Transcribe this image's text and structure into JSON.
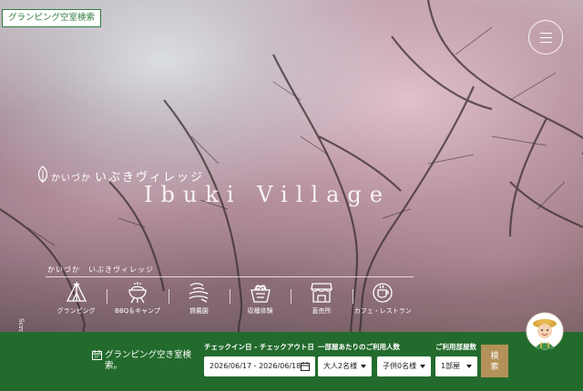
{
  "header": {
    "badge_label": "グランピング空室検索",
    "menu_icon": "hamburger-icon"
  },
  "hero": {
    "logo_small": "かいづか",
    "logo_big": "いぶきヴィレッジ",
    "logo_en": "Ibuki Village"
  },
  "categories": {
    "title": "かいづか　いぶきヴィレッジ",
    "items": [
      {
        "label": "グランピング",
        "icon": "tent-icon"
      },
      {
        "label": "BBQ＆キャンプ",
        "icon": "grill-icon"
      },
      {
        "label": "貸農園",
        "icon": "farm-icon"
      },
      {
        "label": "収穫体験",
        "icon": "harvest-basket-icon"
      },
      {
        "label": "直売所",
        "icon": "shop-icon"
      },
      {
        "label": "カフェ・レストラン",
        "icon": "cafe-icon"
      }
    ]
  },
  "scroll_label": "Scroll",
  "search": {
    "title": "グランピング空き室検索。",
    "date_label": "チェックイン日 - チェックアウト日",
    "date_value": "2026/06/17 - 2026/06/18",
    "guests_label": "一部屋あたりのご利用人数",
    "adults_value": "大人2名様",
    "children_value": "子供0名様",
    "rooms_label": "ご利用部屋数",
    "rooms_value": "1部屋",
    "button_line1": "検",
    "button_line2": "索"
  },
  "colors": {
    "brand_green": "#236b2d",
    "button_gold": "#b39158"
  }
}
